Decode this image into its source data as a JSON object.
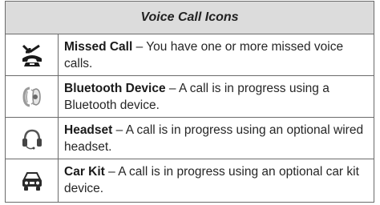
{
  "table": {
    "title": "Voice Call Icons",
    "rows": [
      {
        "icon": "missed-call-icon",
        "name": "Missed Call",
        "separator": " – ",
        "desc": "You have one or more missed voice calls."
      },
      {
        "icon": "bluetooth-device-icon",
        "name": "Bluetooth Device",
        "separator": " – ",
        "desc": "A call is in progress using a Bluetooth device."
      },
      {
        "icon": "headset-icon",
        "name": "Headset",
        "separator": " – ",
        "desc": "A call is in progress using an optional wired headset."
      },
      {
        "icon": "car-kit-icon",
        "name": "Car Kit",
        "separator": " – ",
        "desc": "A call is in progress using an optional car kit device."
      }
    ]
  }
}
